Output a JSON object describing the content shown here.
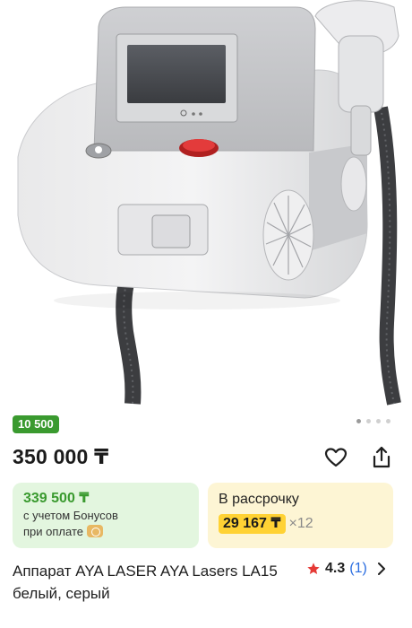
{
  "image": {
    "alt": "Аппарат AYA LASER AYA Lasers LA15 белый, серый",
    "carousel_pages": 4,
    "active_page": 1
  },
  "bonus_badge": "10 500 ",
  "price": "350 000 ₸",
  "bonus_card": {
    "price": "339 500 ₸",
    "note_line1": "с учетом Бонусов",
    "note_line2": "при оплате"
  },
  "installment_card": {
    "title": "В рассрочку",
    "amount": "29 167 ₸",
    "times": "×12"
  },
  "product_title": "Аппарат AYA LASER AYA Lasers LA15 белый, серый",
  "rating": {
    "value": "4.3",
    "count": "(1)"
  },
  "colors": {
    "accent_green": "#3a9a2f",
    "installment_yellow": "#ffd234",
    "link_blue": "#2a6de0",
    "star_red": "#e53935"
  },
  "icons": [
    "heart-icon",
    "share-icon",
    "star-icon",
    "chevron-right-icon",
    "bonus-coin-icon"
  ]
}
